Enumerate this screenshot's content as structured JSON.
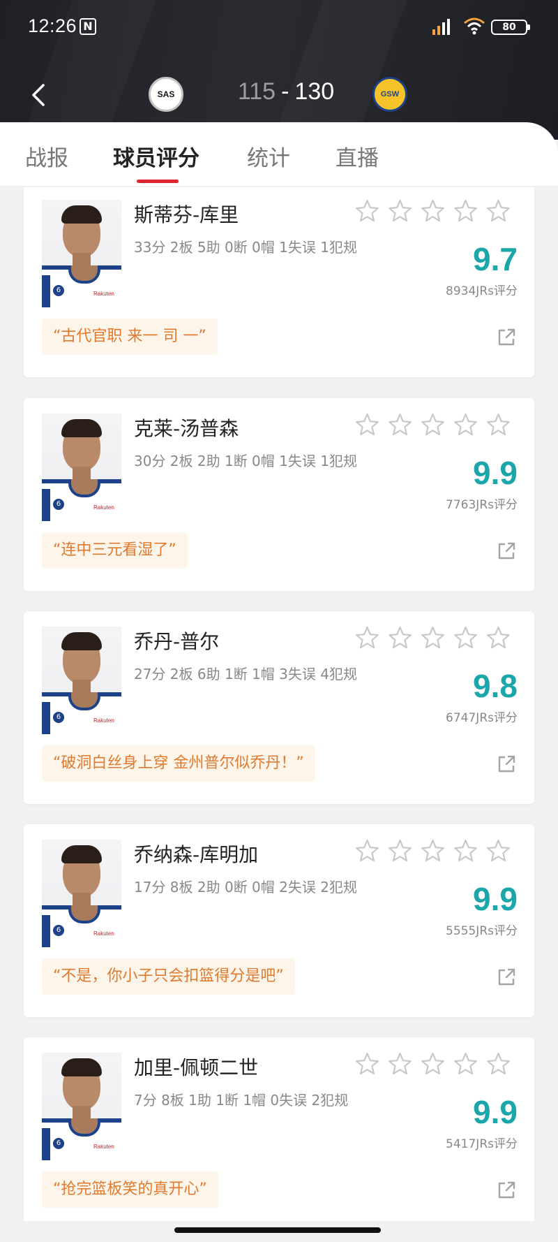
{
  "status_bar": {
    "time": "12:26",
    "battery": "80"
  },
  "match": {
    "home_team": "SAS",
    "away_team": "GSW",
    "home_score": "115",
    "separator": "-",
    "away_score": "130"
  },
  "tabs": [
    {
      "label": "战报"
    },
    {
      "label": "球员评分"
    },
    {
      "label": "统计"
    },
    {
      "label": "直播"
    }
  ],
  "active_tab": "球员评分",
  "players": [
    {
      "name": "斯蒂芬-库里",
      "stats": "33分 2板 5助 0断 0帽 1失误 1犯规",
      "rating": "9.7",
      "votes": "8934JRs评分",
      "comment": "“古代官职 来一 司 一”"
    },
    {
      "name": "克莱-汤普森",
      "stats": "30分 2板 2助 1断 0帽 1失误 1犯规",
      "rating": "9.9",
      "votes": "7763JRs评分",
      "comment": "“连中三元看湿了”"
    },
    {
      "name": "乔丹-普尔",
      "stats": "27分 2板 6助 1断 1帽 3失误 4犯规",
      "rating": "9.8",
      "votes": "6747JRs评分",
      "comment": "“破洞白丝身上穿 金州普尔似乔丹！”"
    },
    {
      "name": "乔纳森-库明加",
      "stats": "17分 8板 2助 0断 0帽 2失误 2犯规",
      "rating": "9.9",
      "votes": "5555JRs评分",
      "comment": "“不是，你小子只会扣篮得分是吧”"
    },
    {
      "name": "加里-佩顿二世",
      "stats": "7分 8板 1助 1断 1帽 0失误 2犯规",
      "rating": "9.9",
      "votes": "5417JRs评分",
      "comment": "“抢完篮板笑的真开心”"
    }
  ],
  "colors": {
    "accent_red": "#e0262e",
    "rating_teal": "#1ba6a9",
    "comment_orange": "#e07a2e",
    "comment_bg": "#fdf5ea",
    "header_dark": "#1f2025"
  },
  "icons": {
    "back": "chevron-left-icon",
    "star": "star-outline-icon",
    "share": "share-external-icon"
  }
}
